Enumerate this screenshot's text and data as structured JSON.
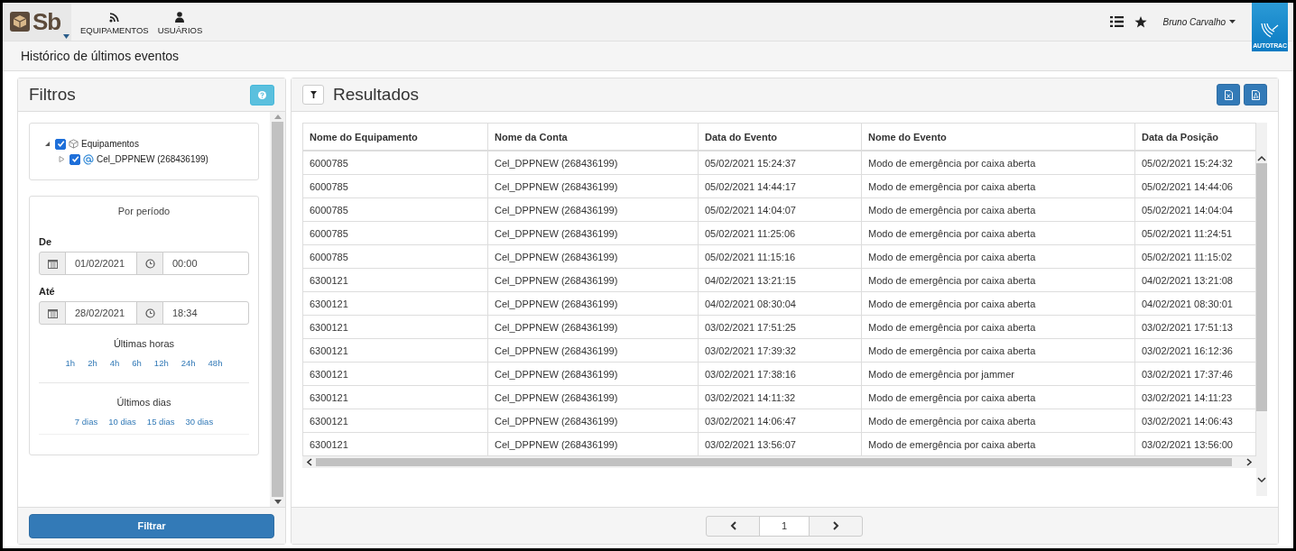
{
  "app": {
    "logo": "Sb",
    "nav": [
      {
        "label": "EQUIPAMENTOS",
        "kind": "rss"
      },
      {
        "label": "USUÁRIOS",
        "kind": "user"
      }
    ],
    "user": "Bruno Carvalho",
    "brand": "AUTOTRAC"
  },
  "page_title": "Histórico de últimos eventos",
  "filters": {
    "title": "Filtros",
    "tree": [
      {
        "label": "Equipamentos",
        "kind": "group",
        "checked": true,
        "expanded": true,
        "children": [
          {
            "label": "Cel_DPPNEW (268436199)",
            "kind": "account",
            "checked": true,
            "expanded": false
          }
        ]
      }
    ],
    "period": {
      "title": "Por período",
      "from": {
        "label": "De",
        "date": "01/02/2021",
        "time": "00:00"
      },
      "to": {
        "label": "Até",
        "date": "28/02/2021",
        "time": "18:34"
      },
      "hours_title": "Últimas horas",
      "hours": [
        "1h",
        "2h",
        "4h",
        "6h",
        "12h",
        "24h",
        "48h"
      ],
      "days_title": "Últimos dias",
      "days": [
        "7 dias",
        "10 dias",
        "15 dias",
        "30 dias"
      ]
    },
    "apply_button": "Filtrar"
  },
  "results": {
    "title": "Resultados",
    "columns": [
      "Nome do Equipamento",
      "Nome da Conta",
      "Data do Evento",
      "Nome do Evento",
      "Data da Posição"
    ],
    "rows": [
      [
        "6000785",
        "Cel_DPPNEW (268436199)",
        "05/02/2021 15:24:37",
        "Modo de emergência por caixa aberta",
        "05/02/2021 15:24:32"
      ],
      [
        "6000785",
        "Cel_DPPNEW (268436199)",
        "05/02/2021 14:44:17",
        "Modo de emergência por caixa aberta",
        "05/02/2021 14:44:06"
      ],
      [
        "6000785",
        "Cel_DPPNEW (268436199)",
        "05/02/2021 14:04:07",
        "Modo de emergência por caixa aberta",
        "05/02/2021 14:04:04"
      ],
      [
        "6000785",
        "Cel_DPPNEW (268436199)",
        "05/02/2021 11:25:06",
        "Modo de emergência por caixa aberta",
        "05/02/2021 11:24:51"
      ],
      [
        "6000785",
        "Cel_DPPNEW (268436199)",
        "05/02/2021 11:15:16",
        "Modo de emergência por caixa aberta",
        "05/02/2021 11:15:02"
      ],
      [
        "6300121",
        "Cel_DPPNEW (268436199)",
        "04/02/2021 13:21:15",
        "Modo de emergência por caixa aberta",
        "04/02/2021 13:21:08"
      ],
      [
        "6300121",
        "Cel_DPPNEW (268436199)",
        "04/02/2021 08:30:04",
        "Modo de emergência por caixa aberta",
        "04/02/2021 08:30:01"
      ],
      [
        "6300121",
        "Cel_DPPNEW (268436199)",
        "03/02/2021 17:51:25",
        "Modo de emergência por caixa aberta",
        "03/02/2021 17:51:13"
      ],
      [
        "6300121",
        "Cel_DPPNEW (268436199)",
        "03/02/2021 17:39:32",
        "Modo de emergência por caixa aberta",
        "03/02/2021 16:12:36"
      ],
      [
        "6300121",
        "Cel_DPPNEW (268436199)",
        "03/02/2021 17:38:16",
        "Modo de emergência por jammer",
        "03/02/2021 17:37:46"
      ],
      [
        "6300121",
        "Cel_DPPNEW (268436199)",
        "03/02/2021 14:11:32",
        "Modo de emergência por caixa aberta",
        "03/02/2021 14:11:23"
      ],
      [
        "6300121",
        "Cel_DPPNEW (268436199)",
        "03/02/2021 14:06:47",
        "Modo de emergência por caixa aberta",
        "03/02/2021 14:06:43"
      ],
      [
        "6300121",
        "Cel_DPPNEW (268436199)",
        "03/02/2021 13:56:07",
        "Modo de emergência por caixa aberta",
        "03/02/2021 13:56:00"
      ]
    ],
    "pages": [
      {
        "label": "1",
        "selected": true
      }
    ]
  }
}
